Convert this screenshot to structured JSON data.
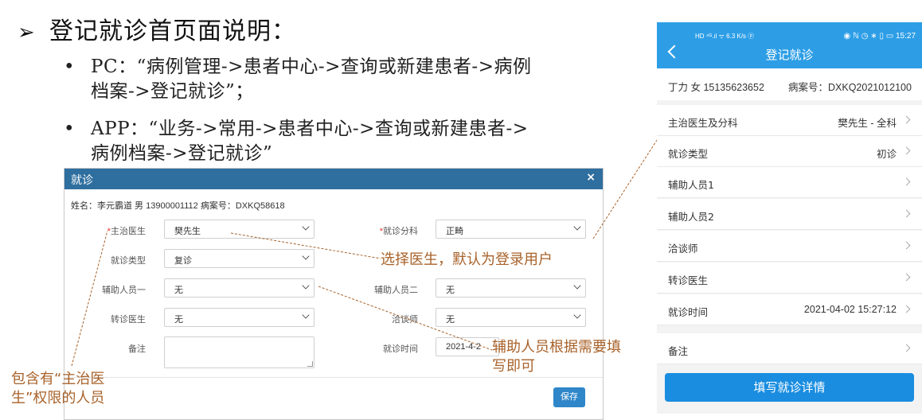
{
  "slide": {
    "arrow": "➢",
    "title": "登记就诊首页面说明：",
    "bullets": [
      {
        "dot": "•",
        "line1": "PC：“病例管理->患者中心->查询或新建患者->病例",
        "line2": "档案->登记就诊”；"
      },
      {
        "dot": "•",
        "line1": "APP：“业务->常用->患者中心->查询或新建患者->",
        "line2": "病例档案->登记就诊”"
      }
    ]
  },
  "dialog": {
    "title": "就诊",
    "close": "×",
    "patient_info": "姓名：李元霸道 男 13900001112 病案号：DXKQ58618",
    "fields": {
      "doctor": {
        "label": "主治医生",
        "required": "*",
        "value": "樊先生"
      },
      "department": {
        "label": "就诊分科",
        "required": "*",
        "value": "正畸"
      },
      "visit_type": {
        "label": "就诊类型",
        "value": "复诊"
      },
      "assistant1": {
        "label": "辅助人员一",
        "value": "无"
      },
      "assistant2": {
        "label": "辅助人员二",
        "value": "无"
      },
      "referral_doctor": {
        "label": "转诊医生",
        "value": "无"
      },
      "consultant": {
        "label": "洽谈师",
        "value": "无"
      },
      "remark": {
        "label": "备注",
        "value": ""
      },
      "visit_time": {
        "label": "就诊时间",
        "value": "2021-4-2"
      }
    },
    "save_label": "保存"
  },
  "annotations": {
    "select_doctor": "选择医生，默认为登录用户",
    "assistant_line1": "辅助人员根据需要填",
    "assistant_line2": "写即可",
    "attending_line1": "包含有“主治医",
    "attending_line2": "生”权限的人员"
  },
  "phone": {
    "status_left": "HD ⁴ᴳ.ıl ᯤ 6.3 K/s ⓟ",
    "status_right": "◉ ℕ ◷ ∗ ▯ ▭ 15:27",
    "title": "登记就诊",
    "patient": "丁力 女 15135623652",
    "case_no": "病案号：DXKQ2021012100",
    "rows": [
      {
        "label": "主治医生及分科",
        "value": "樊先生 - 全科"
      },
      {
        "label": "就诊类型",
        "value": "初诊"
      },
      {
        "label": "辅助人员1",
        "value": ""
      },
      {
        "label": "辅助人员2",
        "value": ""
      },
      {
        "label": "洽谈师",
        "value": ""
      },
      {
        "label": "转诊医生",
        "value": ""
      },
      {
        "label": "就诊时间",
        "value": "2021-04-02 15:27:12"
      },
      {
        "label": "备注",
        "value": ""
      }
    ],
    "button": "填写就诊详情"
  },
  "colors": {
    "dialog_header": "#2f6f9f",
    "phone_header": "#2d9ee6",
    "annotation": "#a8622a",
    "required": "#e33333",
    "button": "#1a8de0"
  }
}
